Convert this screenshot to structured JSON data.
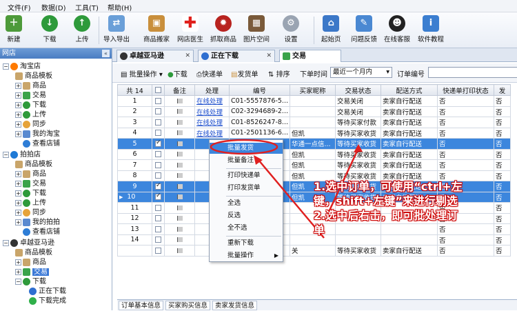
{
  "menu": [
    "文件(F)",
    "数据(D)",
    "工具(T)",
    "帮助(H)"
  ],
  "toolbar": {
    "items": [
      "新建",
      "下载",
      "上传",
      "导入导出",
      "商品搬家",
      "网店医生",
      "抓取商品",
      "图片空间",
      "设置",
      "起始页",
      "问题反馈",
      "在线客服",
      "软件教程"
    ]
  },
  "left": {
    "header": "网店",
    "nodes": [
      "淘宝店",
      "商品模板",
      "商品",
      "交易",
      "下载",
      "上传",
      "同步",
      "我的淘宝",
      "查看店铺",
      "拍拍店",
      "商品模板",
      "商品",
      "交易",
      "下载",
      "上传",
      "同步",
      "我的拍拍",
      "查看店铺",
      "卓越亚马逊",
      "商品模板",
      "商品",
      "交易",
      "下载",
      "正在下载",
      "下载完成"
    ]
  },
  "tabs": [
    "卓越亚马逊",
    "正在下载",
    "交易"
  ],
  "subbar": {
    "batch": "批量操作",
    "download": "下载",
    "quick_print": "快递单",
    "ship_print": "发货单",
    "sort": "排序",
    "time_label": "下单时间",
    "time_value": "最近一个月内",
    "order_label": "订单编号"
  },
  "grid": {
    "columns": [
      "共 14",
      "",
      "备注",
      "处理",
      "编号",
      "买家昵称",
      "交易状态",
      "配送方式",
      "快递单打印状态",
      "发"
    ],
    "rows": [
      {
        "n": "1",
        "checked": false,
        "op": "在线处理",
        "id": "C01-5557876-5...",
        "buyer": "",
        "status": "交易关闭",
        "ship": "卖家自行配送",
        "print": "否",
        "f": "否",
        "hl": false
      },
      {
        "n": "2",
        "checked": false,
        "op": "在线处理",
        "id": "C02-3294689-2...",
        "buyer": "",
        "status": "交易关闭",
        "ship": "卖家自行配送",
        "print": "否",
        "f": "否",
        "hl": false
      },
      {
        "n": "3",
        "checked": false,
        "op": "在线处理",
        "id": "C01-8526247-8...",
        "buyer": "",
        "status": "等待买家付款",
        "ship": "卖家自行配送",
        "print": "否",
        "f": "否",
        "hl": false
      },
      {
        "n": "4",
        "checked": false,
        "op": "在线处理",
        "id": "C01-2501136-6...",
        "buyer": "但凯",
        "status": "等待买家收货",
        "ship": "卖家自行配送",
        "print": "否",
        "f": "否",
        "hl": false
      },
      {
        "n": "5",
        "checked": true,
        "op": "",
        "id": "...509-4...",
        "buyer": "华通一点信...",
        "status": "等待买家收货",
        "ship": "卖家自行配送",
        "print": "否",
        "f": "否",
        "hl": true
      },
      {
        "n": "6",
        "checked": false,
        "op": "",
        "id": "...-1...",
        "buyer": "但凯",
        "status": "等待买家收货",
        "ship": "卖家自行配送",
        "print": "否",
        "f": "否",
        "hl": false
      },
      {
        "n": "7",
        "checked": false,
        "op": "",
        "id": "...-12-3...",
        "buyer": "但凯",
        "status": "等待买家收货",
        "ship": "卖家自行配送",
        "print": "否",
        "f": "否",
        "hl": false
      },
      {
        "n": "8",
        "checked": false,
        "op": "",
        "id": "...-3...",
        "buyer": "但凯",
        "status": "等待买家收货",
        "ship": "卖家自行配送",
        "print": "否",
        "f": "否",
        "hl": false
      },
      {
        "n": "9",
        "checked": true,
        "op": "",
        "id": "...729-1...",
        "buyer": "但凯",
        "status": "等待买家收货",
        "ship": "卖家自行配送",
        "print": "否",
        "f": "否",
        "hl": true
      },
      {
        "n": "10",
        "checked": true,
        "op": "",
        "id": "...4-7...",
        "buyer": "但凯",
        "status": "等待买家收货",
        "ship": "卖家自行配送",
        "print": "否",
        "f": "否",
        "hl": true
      },
      {
        "n": "11",
        "checked": false,
        "op": "",
        "id": "",
        "buyer": "",
        "status": "",
        "ship": "",
        "print": "否",
        "f": "否",
        "hl": false
      },
      {
        "n": "12",
        "checked": false,
        "op": "",
        "id": "",
        "buyer": "",
        "status": "",
        "ship": "",
        "print": "否",
        "f": "否",
        "hl": false
      },
      {
        "n": "13",
        "checked": false,
        "op": "",
        "id": "",
        "buyer": "",
        "status": "",
        "ship": "",
        "print": "否",
        "f": "否",
        "hl": false
      },
      {
        "n": "14",
        "checked": false,
        "op": "",
        "id": "",
        "buyer": "",
        "status": "",
        "ship": "",
        "print": "否",
        "f": "否",
        "hl": false
      },
      {
        "n": "",
        "checked": false,
        "op": "",
        "id": "",
        "buyer": "关",
        "status": "等待买家收货",
        "ship": "卖家自行配送",
        "print": "否",
        "f": "否",
        "hl": false
      }
    ]
  },
  "context_menu": [
    "批量发货",
    "批量备注",
    "打印快递单",
    "打印发货单",
    "全选",
    "反选",
    "全不选",
    "重新下载",
    "批量操作"
  ],
  "bottom_tabs": [
    "订单基本信息",
    "买家购买信息",
    "卖家发货信息"
  ],
  "annotation": {
    "line1": "1.选中订单，可使用“ctrl+左",
    "line2": "键，shift+左键”来进行剔选",
    "line3": "2.选中后右击，即可批处理订",
    "line4": "单"
  }
}
